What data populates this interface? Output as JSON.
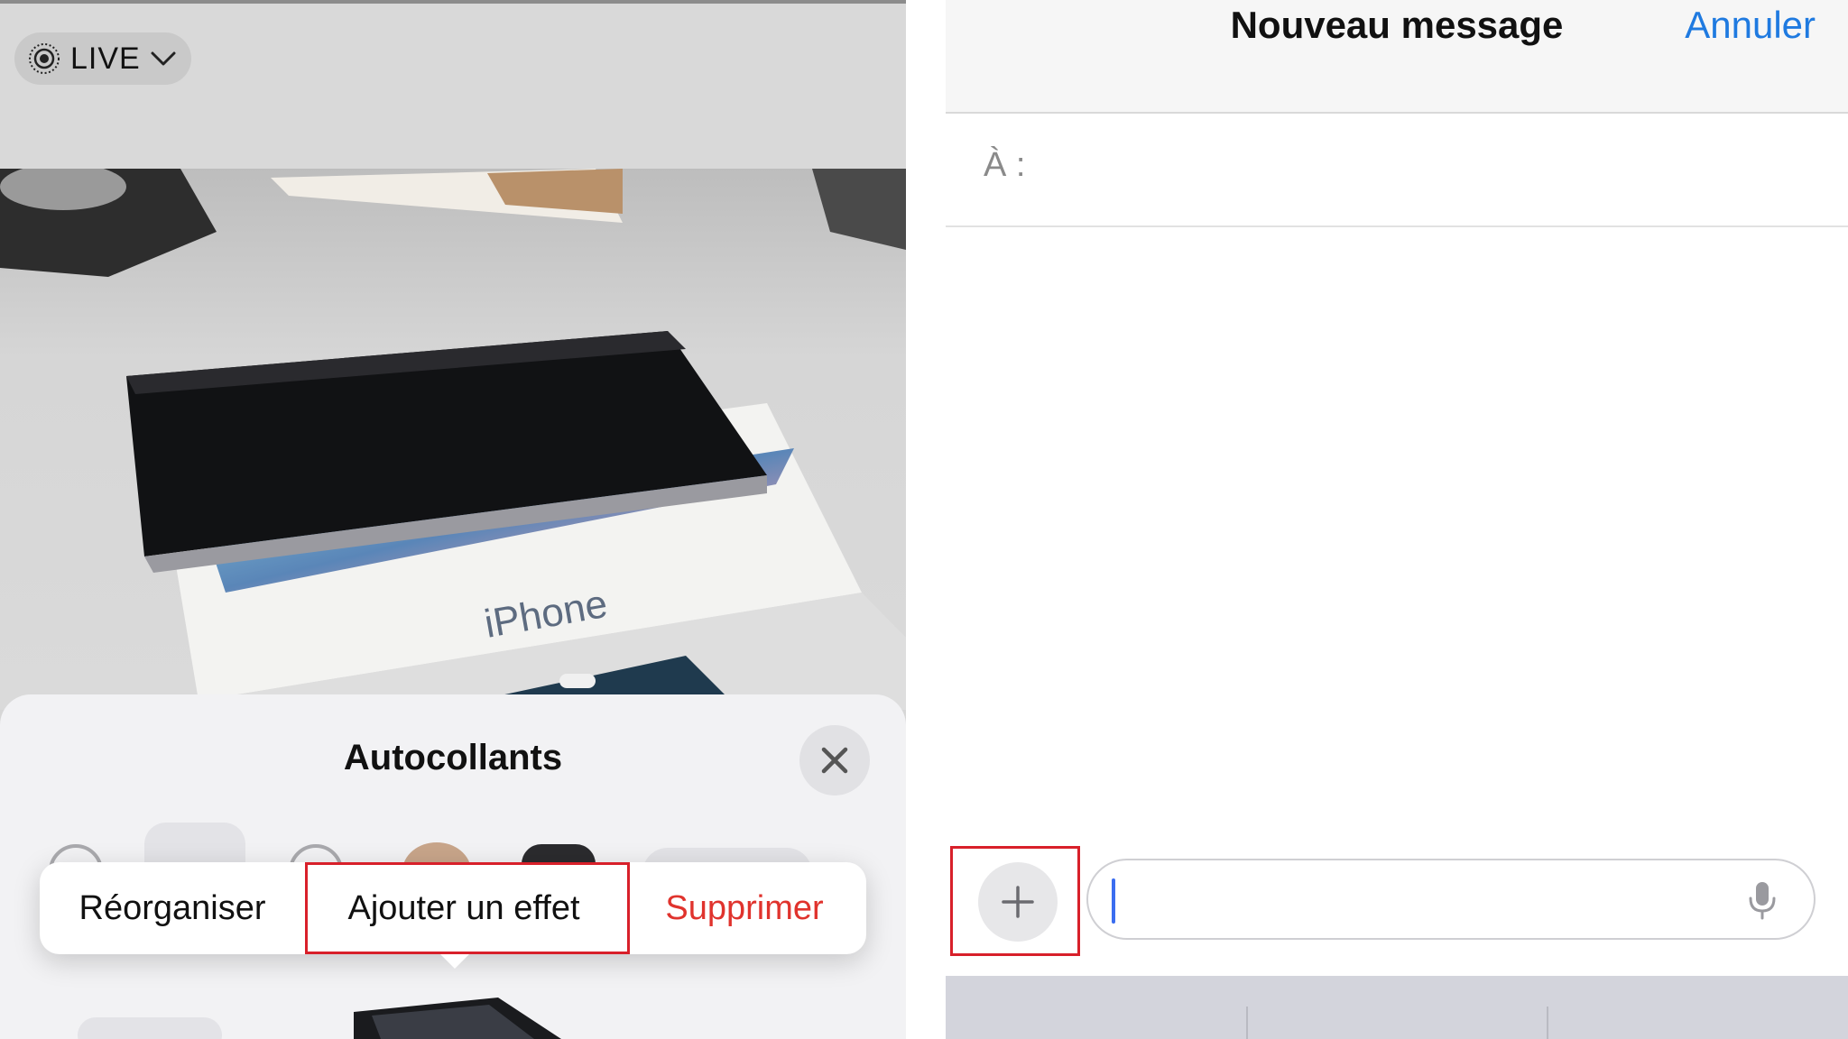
{
  "left_panel": {
    "live_button": {
      "label": "LIVE",
      "icon": "live-photo-icon",
      "chevron": "chevron-down-icon"
    },
    "photo": {
      "box_text": "iPhone"
    },
    "sticker_sheet": {
      "title": "Autocollants",
      "close_icon": "close-icon",
      "context_menu": {
        "items": [
          {
            "label": "Réorganiser",
            "color": "#111111"
          },
          {
            "label": "Ajouter un effet",
            "color": "#111111",
            "highlighted": true
          },
          {
            "label": "Supprimer",
            "color": "#e0332d"
          }
        ]
      }
    }
  },
  "right_panel": {
    "header": {
      "title": "Nouveau message",
      "cancel_label": "Annuler",
      "cancel_color": "#1f7ae0"
    },
    "recipient": {
      "label": "À :"
    },
    "composer": {
      "plus_icon": "plus-icon",
      "plus_highlighted": true,
      "input_value": "",
      "mic_icon": "microphone-icon"
    }
  },
  "highlight_color": "#d8202a"
}
